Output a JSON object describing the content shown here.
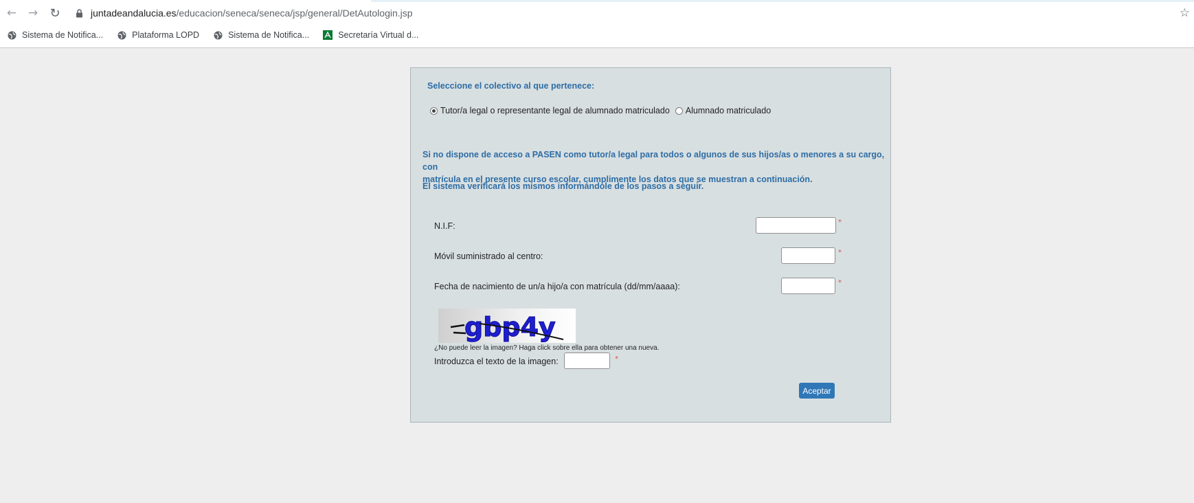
{
  "browser": {
    "url_host": "juntadeandalucia.es",
    "url_path": "/educacion/seneca/seneca/jsp/general/DetAutologin.jsp",
    "bookmarks": [
      {
        "label": "Sistema de Notifica...",
        "icon": "globe-icon"
      },
      {
        "label": "Plataforma LOPD",
        "icon": "globe-icon"
      },
      {
        "label": "Sistema de Notifica...",
        "icon": "globe-icon"
      },
      {
        "label": "Secretaría Virtual d...",
        "icon": "junta-logo-icon"
      }
    ]
  },
  "form": {
    "heading": "Seleccione el colectivo al que pertenece:",
    "radio_options": [
      {
        "label": "Tutor/a legal o representante legal de alumnado matriculado",
        "checked": true
      },
      {
        "label": "Alumnado matriculado",
        "checked": false
      }
    ],
    "info_text_1": "Si no dispone de acceso a PASEN como tutor/a legal para todos o algunos de sus hijos/as o menores a su cargo, con",
    "info_text_1b": "matrícula en el presente curso escolar, cumplimente los datos que se muestran a continuación.",
    "info_text_2": "El sistema verificará los mismos informándole de los pasos a seguir.",
    "fields": {
      "nif_label": "N.I.F:",
      "movil_label": "Móvil suministrado al centro:",
      "fecha_label": "Fecha de nacimiento de un/a hijo/a con matrícula (dd/mm/aaaa):",
      "required_mark": "*"
    },
    "captcha": {
      "text": "gbp4y",
      "note": "¿No puede leer la imagen? Haga click sobre ella para obtener una nueva.",
      "input_label": "Introduzca el texto de la imagen:"
    },
    "submit_label": "Aceptar",
    "colors": {
      "accent": "#2e6da4",
      "button": "#2f77b7",
      "panel": "#d8dfe1"
    }
  }
}
